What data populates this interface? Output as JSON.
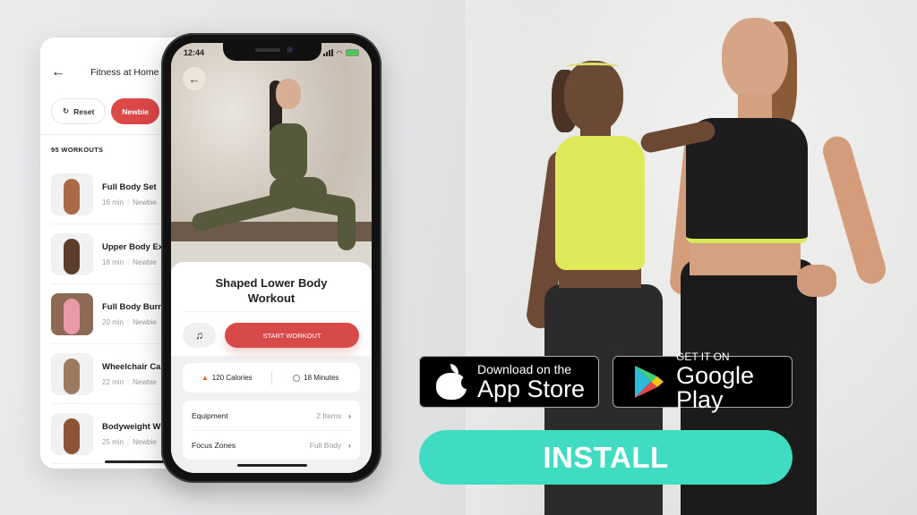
{
  "list_screen": {
    "title": "Fitness at Home",
    "back_icon": "arrow-left",
    "chips": [
      {
        "label": "Reset",
        "icon": "refresh",
        "active": false
      },
      {
        "label": "Newbie",
        "active": true
      }
    ],
    "workout_count": "95 WORKOUTS",
    "workouts": [
      {
        "name": "Full Body Set",
        "duration": "16 min",
        "level": "Newbie"
      },
      {
        "name": "Upper Body Ex",
        "duration": "18 min",
        "level": "Newbie"
      },
      {
        "name": "Full Body Burn",
        "duration": "20 min",
        "level": "Newbie"
      },
      {
        "name": "Wheelchair Ca",
        "duration": "22 min",
        "level": "Newbie"
      },
      {
        "name": "Bodyweight W",
        "duration": "25 min",
        "level": "Newbie"
      }
    ]
  },
  "detail_screen": {
    "status_time": "12:44",
    "title": "Shaped Lower Body Workout",
    "music_icon": "music-note",
    "start_label": "START WORKOUT",
    "calories": "120 Calories",
    "duration": "18 Minutes",
    "rows": [
      {
        "label": "Equipment",
        "value": "2 Items"
      },
      {
        "label": "Focus Zones",
        "value": "Full Body"
      }
    ]
  },
  "store_badges": {
    "apple_small": "Download on the",
    "apple_big": "App Store",
    "google_small": "GET IT ON",
    "google_big": "Google Play"
  },
  "install_label": "INSTALL",
  "colors": {
    "accent_red": "#dd4848",
    "install_teal": "#3fdcc2"
  }
}
